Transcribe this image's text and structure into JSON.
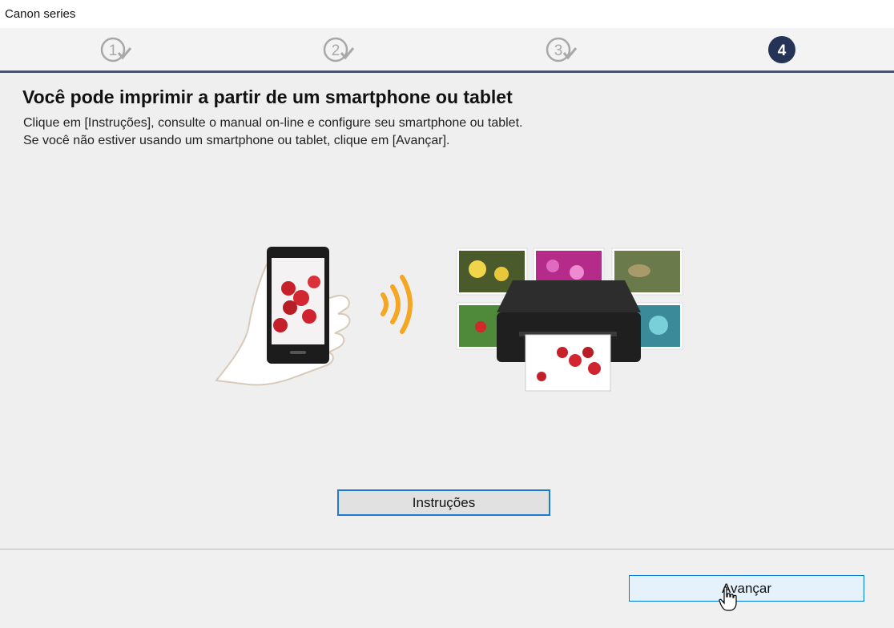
{
  "window": {
    "title": "Canon series"
  },
  "steps": [
    {
      "number": "1",
      "state": "done"
    },
    {
      "number": "2",
      "state": "done"
    },
    {
      "number": "3",
      "state": "done"
    },
    {
      "number": "4",
      "state": "current"
    }
  ],
  "content": {
    "heading": "Você pode imprimir a partir de um smartphone ou tablet",
    "line1": "Clique em [Instruções], consulte o manual on-line e configure seu smartphone ou tablet.",
    "line2": "Se você não estiver usando um smartphone ou tablet, clique em [Avançar]."
  },
  "buttons": {
    "instructions": "Instruções",
    "next": "Avançar"
  },
  "colors": {
    "step_active": "#253456",
    "step_done": "#a8a8a8",
    "accent": "#0078d7",
    "wifi": "#f5a623"
  }
}
